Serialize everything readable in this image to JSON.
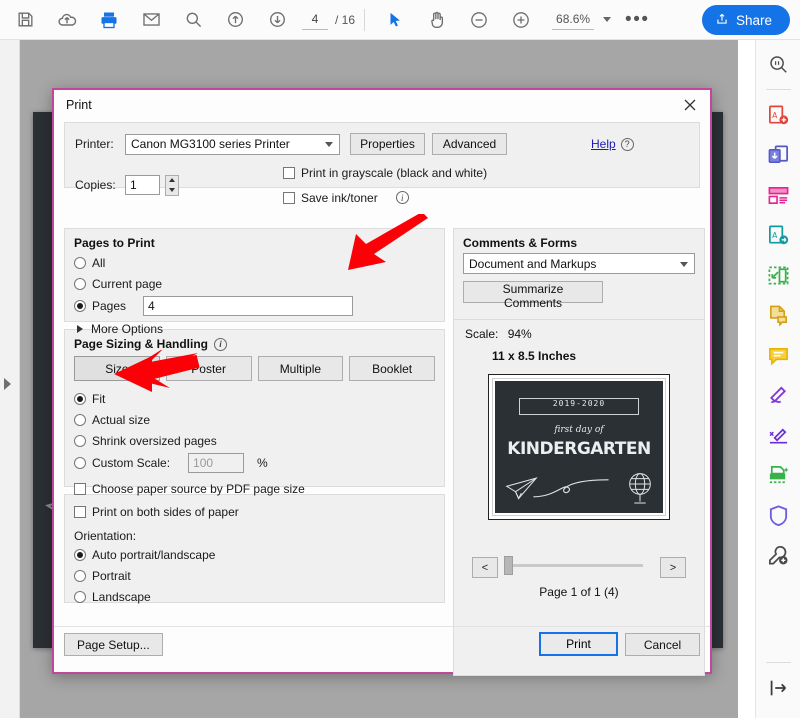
{
  "toolbar": {
    "icons": [
      {
        "name": "save-icon",
        "title": "Save"
      },
      {
        "name": "cloud-upload-icon",
        "title": "Save to cloud"
      },
      {
        "name": "print-icon",
        "title": "Print"
      },
      {
        "name": "email-icon",
        "title": "Email"
      },
      {
        "name": "search-icon",
        "title": "Find"
      },
      {
        "name": "previous-page-icon",
        "title": "Previous page"
      },
      {
        "name": "next-page-icon",
        "title": "Next page"
      }
    ],
    "page_current": "4",
    "page_total": "/ 16",
    "tools": [
      {
        "name": "select-cursor-icon",
        "title": "Select tool"
      },
      {
        "name": "hand-pan-icon",
        "title": "Hand tool"
      },
      {
        "name": "zoom-out-icon",
        "title": "Zoom out"
      },
      {
        "name": "zoom-in-icon",
        "title": "Zoom in"
      }
    ],
    "zoom_level": "68.6%",
    "more_label": "•••",
    "share_label": "Share",
    "share_icon": "share-box-icon",
    "accent_color": "#1473e6"
  },
  "rail": {
    "icons": [
      {
        "name": "search-document-icon",
        "color": "#4a4a4a"
      },
      {
        "name": "create-pdf-icon",
        "color": "#e2453c"
      },
      {
        "name": "combine-files-icon",
        "color": "#5258c8"
      },
      {
        "name": "organize-pages-icon",
        "color": "#e8218f"
      },
      {
        "name": "export-pdf-icon",
        "color": "#0f9ba0"
      },
      {
        "name": "compress-pdf-icon",
        "color": "#38b14a"
      },
      {
        "name": "edit-pdf-icon",
        "color": "#d4a017"
      },
      {
        "name": "comment-icon",
        "color": "#e8b500"
      },
      {
        "name": "fill-and-sign-icon",
        "color": "#8038d8"
      },
      {
        "name": "request-signature-icon",
        "color": "#6b2fd6"
      },
      {
        "name": "scan-ocr-icon",
        "color": "#38b14a"
      },
      {
        "name": "protect-icon",
        "color": "#6b5ce0"
      },
      {
        "name": "more-tools-icon",
        "color": "#4a4a4a"
      },
      {
        "name": "expand-panel-icon",
        "color": "#3a3a3a"
      }
    ]
  },
  "dialog": {
    "title": "Print",
    "close_icon": "close-icon",
    "printer": {
      "label": "Printer:",
      "value": "Canon MG3100 series Printer",
      "properties_label": "Properties",
      "advanced_label": "Advanced",
      "help_label": "Help",
      "help_icon": "question-mark-icon"
    },
    "copies": {
      "label": "Copies:",
      "value": "1",
      "stepper_icon": "spinner-up-down-icon"
    },
    "print_options": [
      {
        "label": "Print in grayscale (black and white)",
        "checked": false
      },
      {
        "label": "Save ink/toner",
        "checked": false,
        "info_icon": "info-icon"
      }
    ],
    "pages_to_print": {
      "title": "Pages to Print",
      "options": [
        {
          "label": "All",
          "selected": false
        },
        {
          "label": "Current page",
          "selected": false
        },
        {
          "label": "Pages",
          "selected": true
        }
      ],
      "pages_value": "4",
      "more_options_label": "More Options",
      "more_options_icon": "triangle-right-icon"
    },
    "page_sizing": {
      "title": "Page Sizing & Handling",
      "info_icon": "info-icon",
      "buttons": [
        {
          "label": "Size",
          "selected": true
        },
        {
          "label": "Poster",
          "selected": false
        },
        {
          "label": "Multiple",
          "selected": false
        },
        {
          "label": "Booklet",
          "selected": false
        }
      ],
      "options": [
        {
          "label": "Fit",
          "selected": true
        },
        {
          "label": "Actual size",
          "selected": false
        },
        {
          "label": "Shrink oversized pages",
          "selected": false
        },
        {
          "label": "Custom Scale:",
          "selected": false
        }
      ],
      "custom_scale_value": "100",
      "percent_label": "%",
      "paper_source_label": "Choose paper source by PDF page size",
      "paper_source_checked": false
    },
    "duplex": {
      "label": "Print on both sides of paper",
      "checked": false
    },
    "orientation": {
      "title": "Orientation:",
      "options": [
        {
          "label": "Auto portrait/landscape",
          "selected": true
        },
        {
          "label": "Portrait",
          "selected": false
        },
        {
          "label": "Landscape",
          "selected": false
        }
      ]
    },
    "comments_forms": {
      "title": "Comments & Forms",
      "value": "Document and Markups",
      "summarize_label": "Summarize Comments"
    },
    "scale_label": "Scale:",
    "scale_value": "94%",
    "preview": {
      "sheet_size": "11 x 8.5 Inches",
      "art": {
        "year": "2019-2020",
        "script": "first day of",
        "title": "KINDERGARTEN",
        "plane_icon": "paper-plane-icon",
        "globe_icon": "globe-icon"
      },
      "prev_label": "<",
      "next_label": ">",
      "page_status": "Page 1 of 1 (4)"
    },
    "footer": {
      "page_setup_label": "Page Setup...",
      "print_label": "Print",
      "cancel_label": "Cancel"
    },
    "border_color": "#c1479a"
  },
  "annotations": {
    "arrows": [
      {
        "name": "arrow-pointing-to-pages-field",
        "color": "#fb0007",
        "direction": "down-left"
      },
      {
        "name": "arrow-pointing-to-fit-option",
        "color": "#fb0007",
        "direction": "left"
      }
    ]
  }
}
